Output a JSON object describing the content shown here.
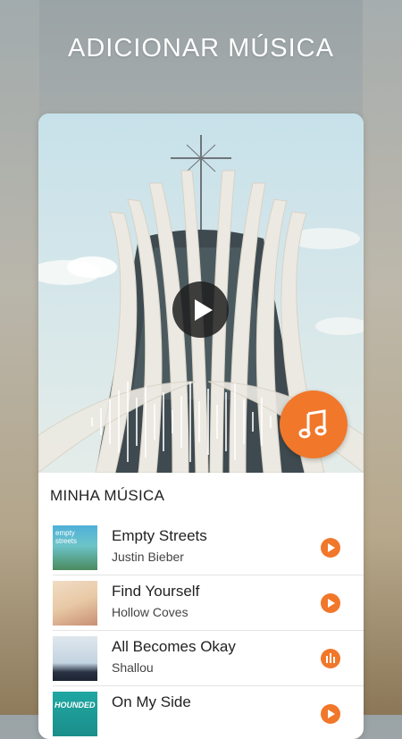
{
  "header": {
    "title": "ADICIONAR MÚSICA"
  },
  "section": {
    "label": "MINHA MÚSICA"
  },
  "tracks": [
    {
      "title": "Empty Streets",
      "artist": "Justin Bieber",
      "action": "play-icon",
      "thumb_text": "empty streets"
    },
    {
      "title": "Find Yourself",
      "artist": "Hollow  Coves",
      "action": "play-icon",
      "thumb_text": ""
    },
    {
      "title": "All Becomes Okay",
      "artist": "Shallou",
      "action": "equalizer-icon",
      "thumb_text": ""
    },
    {
      "title": "On My Side",
      "artist": "",
      "action": "play-icon",
      "thumb_text": "HOUNDED"
    }
  ],
  "colors": {
    "accent": "#f1772a",
    "sky": "#cfe3ea",
    "text": "#222222"
  }
}
